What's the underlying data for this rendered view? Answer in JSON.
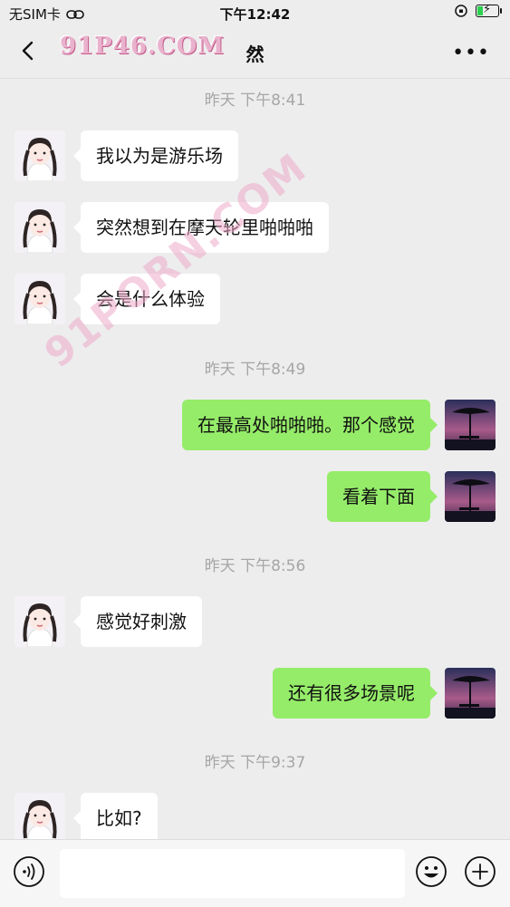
{
  "status_bar": {
    "carrier": "无SIM卡",
    "time": "下午12:42"
  },
  "nav": {
    "title": "然",
    "more": "•••",
    "watermark_logo": "91P46.COM"
  },
  "watermark_diagonal": "91PORN.COM",
  "messages": [
    {
      "type": "time",
      "text": "昨天 下午8:41"
    },
    {
      "type": "in",
      "text": "我以为是游乐场"
    },
    {
      "type": "in",
      "text": "突然想到在摩天轮里啪啪啪"
    },
    {
      "type": "in",
      "text": "会是什么体验"
    },
    {
      "type": "time",
      "text": "昨天 下午8:49"
    },
    {
      "type": "out",
      "text": "在最高处啪啪啪。那个感觉"
    },
    {
      "type": "out",
      "text": "看着下面"
    },
    {
      "type": "time",
      "text": "昨天 下午8:56"
    },
    {
      "type": "in",
      "text": "感觉好刺激"
    },
    {
      "type": "out",
      "text": "还有很多场景呢"
    },
    {
      "type": "time",
      "text": "昨天 下午9:37"
    },
    {
      "type": "in",
      "text": "比如?"
    }
  ],
  "colors": {
    "background": "#ededed",
    "bubble_out": "#95ec69",
    "bubble_in": "#ffffff",
    "timestamp": "#a6a6a6"
  },
  "icons": {
    "back": "chevron-left-icon",
    "voice": "voice-icon",
    "emoji": "emoji-icon",
    "plus": "plus-icon"
  }
}
